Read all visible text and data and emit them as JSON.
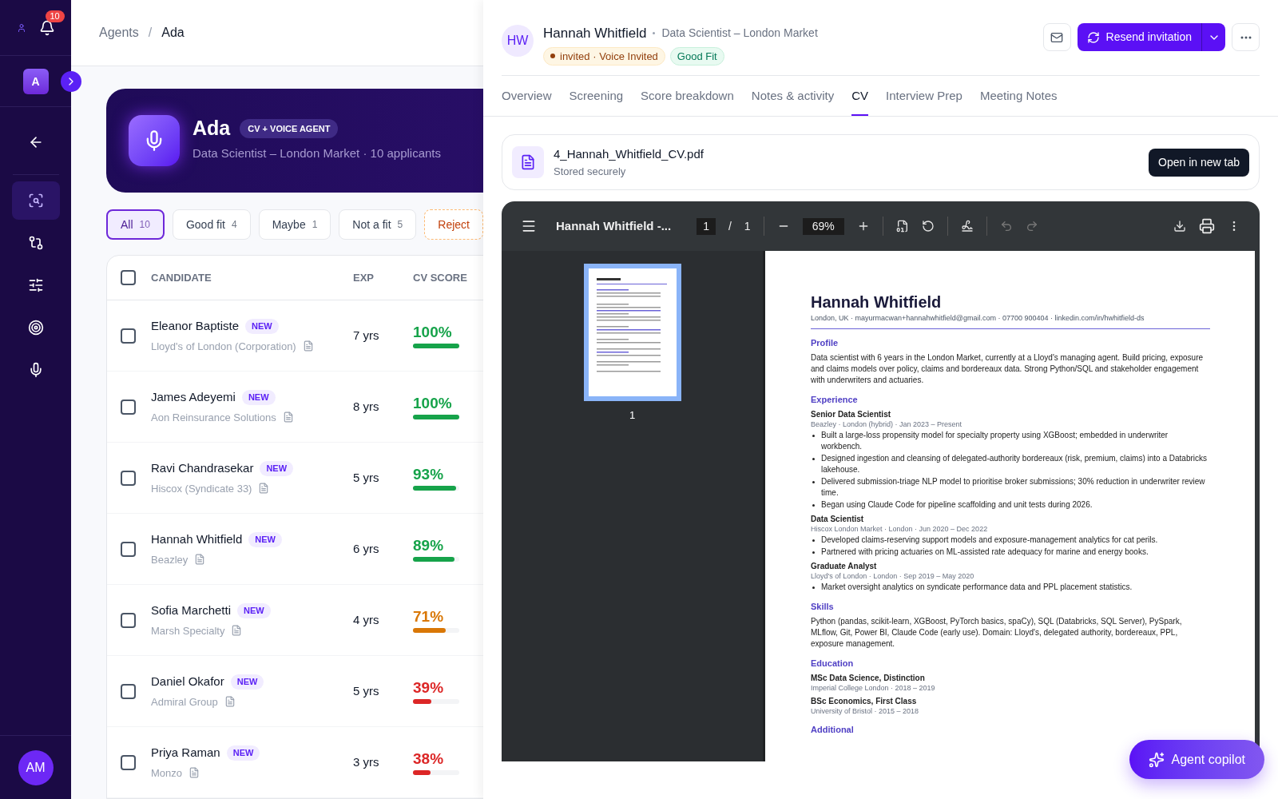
{
  "sidebar": {
    "notifications": "10",
    "workspace": "A",
    "user": "AM",
    "nav": [
      {
        "selected": true
      },
      {
        "selected": false
      },
      {
        "selected": false
      },
      {
        "selected": false
      },
      {
        "selected": false
      }
    ]
  },
  "breadcrumb": {
    "parent": "Agents",
    "separator": "/",
    "current": "Ada"
  },
  "agent": {
    "name": "Ada",
    "tag": "CV + VOICE AGENT",
    "subtitle": "Data Scientist – London Market · 10 applicants"
  },
  "filters": [
    {
      "label": "All",
      "count": "10",
      "selected": true,
      "kind": "normal"
    },
    {
      "label": "Good fit",
      "count": "4",
      "selected": false,
      "kind": "normal"
    },
    {
      "label": "Maybe",
      "count": "1",
      "selected": false,
      "kind": "normal"
    },
    {
      "label": "Not a fit",
      "count": "5",
      "selected": false,
      "kind": "normal"
    },
    {
      "label": "Reject",
      "selected": false,
      "kind": "reject"
    }
  ],
  "table": {
    "all_checked": false,
    "columns": [
      "CANDIDATE",
      "EXP",
      "CV SCORE"
    ],
    "rows": [
      {
        "name": "Eleanor Baptiste",
        "badge": "NEW",
        "company": "Lloyd's of London (Corporation)",
        "exp": "7 yrs",
        "score": "100%",
        "level": 1,
        "color": "#16a34a",
        "checked": false
      },
      {
        "name": "James Adeyemi",
        "badge": "NEW",
        "company": "Aon Reinsurance Solutions",
        "exp": "8 yrs",
        "score": "100%",
        "level": 1,
        "color": "#16a34a",
        "checked": false
      },
      {
        "name": "Ravi Chandrasekar",
        "badge": "NEW",
        "company": "Hiscox (Syndicate 33)",
        "exp": "5 yrs",
        "score": "93%",
        "level": 0.93,
        "color": "#16a34a",
        "checked": false
      },
      {
        "name": "Hannah Whitfield",
        "badge": "NEW",
        "company": "Beazley",
        "exp": "6 yrs",
        "score": "89%",
        "level": 0.89,
        "color": "#16a34a",
        "checked": false
      },
      {
        "name": "Sofia Marchetti",
        "badge": "NEW",
        "company": "Marsh Specialty",
        "exp": "4 yrs",
        "score": "71%",
        "level": 0.71,
        "color": "#d97706",
        "checked": false
      },
      {
        "name": "Daniel Okafor",
        "badge": "NEW",
        "company": "Admiral Group",
        "exp": "5 yrs",
        "score": "39%",
        "level": 0.39,
        "color": "#dc2626",
        "checked": false
      },
      {
        "name": "Priya Raman",
        "badge": "NEW",
        "company": "Monzo",
        "exp": "3 yrs",
        "score": "38%",
        "level": 0.38,
        "color": "#dc2626",
        "checked": false
      }
    ]
  },
  "drawer": {
    "initials": "HW",
    "name": "Hannah Whitfield",
    "role": "Data Scientist – London Market",
    "status": "invited · Voice Invited",
    "fit": "Good Fit",
    "primary_action": "Resend invitation",
    "tabs": [
      {
        "label": "Overview",
        "selected": false
      },
      {
        "label": "Screening",
        "selected": false
      },
      {
        "label": "Score breakdown",
        "selected": false
      },
      {
        "label": "Notes & activity",
        "selected": false
      },
      {
        "label": "CV",
        "selected": true
      },
      {
        "label": "Interview Prep",
        "selected": false
      },
      {
        "label": "Meeting Notes",
        "selected": false
      }
    ],
    "file": {
      "name": "4_Hannah_Whitfield_CV.pdf",
      "note": "Stored securely",
      "action": "Open in new tab"
    },
    "viewer": {
      "title": "Hannah Whitfield -...",
      "page": "1",
      "separator": "/",
      "pages": "1",
      "zoom": "69%",
      "thumbnail_label": "1",
      "thumbnail_selected": true,
      "undo_disabled": true
    },
    "cv": {
      "name": "Hannah Whitfield",
      "contact": "London, UK · mayurmacwan+hannahwhitfield@gmail.com · 07700 900404 · linkedin.com/in/hwhitfield-ds",
      "sections": [
        {
          "heading": "Profile",
          "blocks": [
            {
              "kind": "para",
              "text": "Data scientist with 6 years in the London Market, currently at a Lloyd's managing agent. Build pricing, exposure and claims models over policy, claims and bordereaux data. Strong Python/SQL and stakeholder engagement with underwriters and actuaries."
            }
          ]
        },
        {
          "heading": "Experience",
          "blocks": [
            {
              "kind": "role",
              "text": "Senior Data Scientist"
            },
            {
              "kind": "meta",
              "text": "Beazley · London (hybrid) · Jan 2023 – Present"
            },
            {
              "kind": "bullet",
              "text": "Built a large-loss propensity model for specialty property using XGBoost; embedded in underwriter workbench."
            },
            {
              "kind": "bullet",
              "text": "Designed ingestion and cleansing of delegated-authority bordereaux (risk, premium, claims) into a Databricks lakehouse."
            },
            {
              "kind": "bullet",
              "text": "Delivered submission-triage NLP model to prioritise broker submissions; 30% reduction in underwriter review time."
            },
            {
              "kind": "bullet",
              "text": "Began using Claude Code for pipeline scaffolding and unit tests during 2026."
            },
            {
              "kind": "role",
              "text": "Data Scientist"
            },
            {
              "kind": "meta",
              "text": "Hiscox London Market · London · Jun 2020 – Dec 2022"
            },
            {
              "kind": "bullet",
              "text": "Developed claims-reserving support models and exposure-management analytics for cat perils."
            },
            {
              "kind": "bullet",
              "text": "Partnered with pricing actuaries on ML-assisted rate adequacy for marine and energy books."
            },
            {
              "kind": "role",
              "text": "Graduate Analyst"
            },
            {
              "kind": "meta",
              "text": "Lloyd's of London · London · Sep 2019 – May 2020"
            },
            {
              "kind": "bullet",
              "text": "Market oversight analytics on syndicate performance data and PPL placement statistics."
            }
          ]
        },
        {
          "heading": "Skills",
          "blocks": [
            {
              "kind": "para",
              "text": "Python (pandas, scikit-learn, XGBoost, PyTorch basics, spaCy), SQL (Databricks, SQL Server), PySpark, MLflow, Git, Power BI, Claude Code (early use). Domain: Lloyd's, delegated authority, bordereaux, PPL, exposure management."
            }
          ]
        },
        {
          "heading": "Education",
          "blocks": [
            {
              "kind": "role",
              "text": "MSc Data Science, Distinction"
            },
            {
              "kind": "meta",
              "text": "Imperial College London · 2018 – 2019"
            },
            {
              "kind": "role",
              "text": "BSc Economics, First Class"
            },
            {
              "kind": "meta",
              "text": "University of Bristol · 2015 – 2018"
            }
          ]
        },
        {
          "heading": "Additional"
        }
      ]
    }
  },
  "copilot": "Agent copilot"
}
